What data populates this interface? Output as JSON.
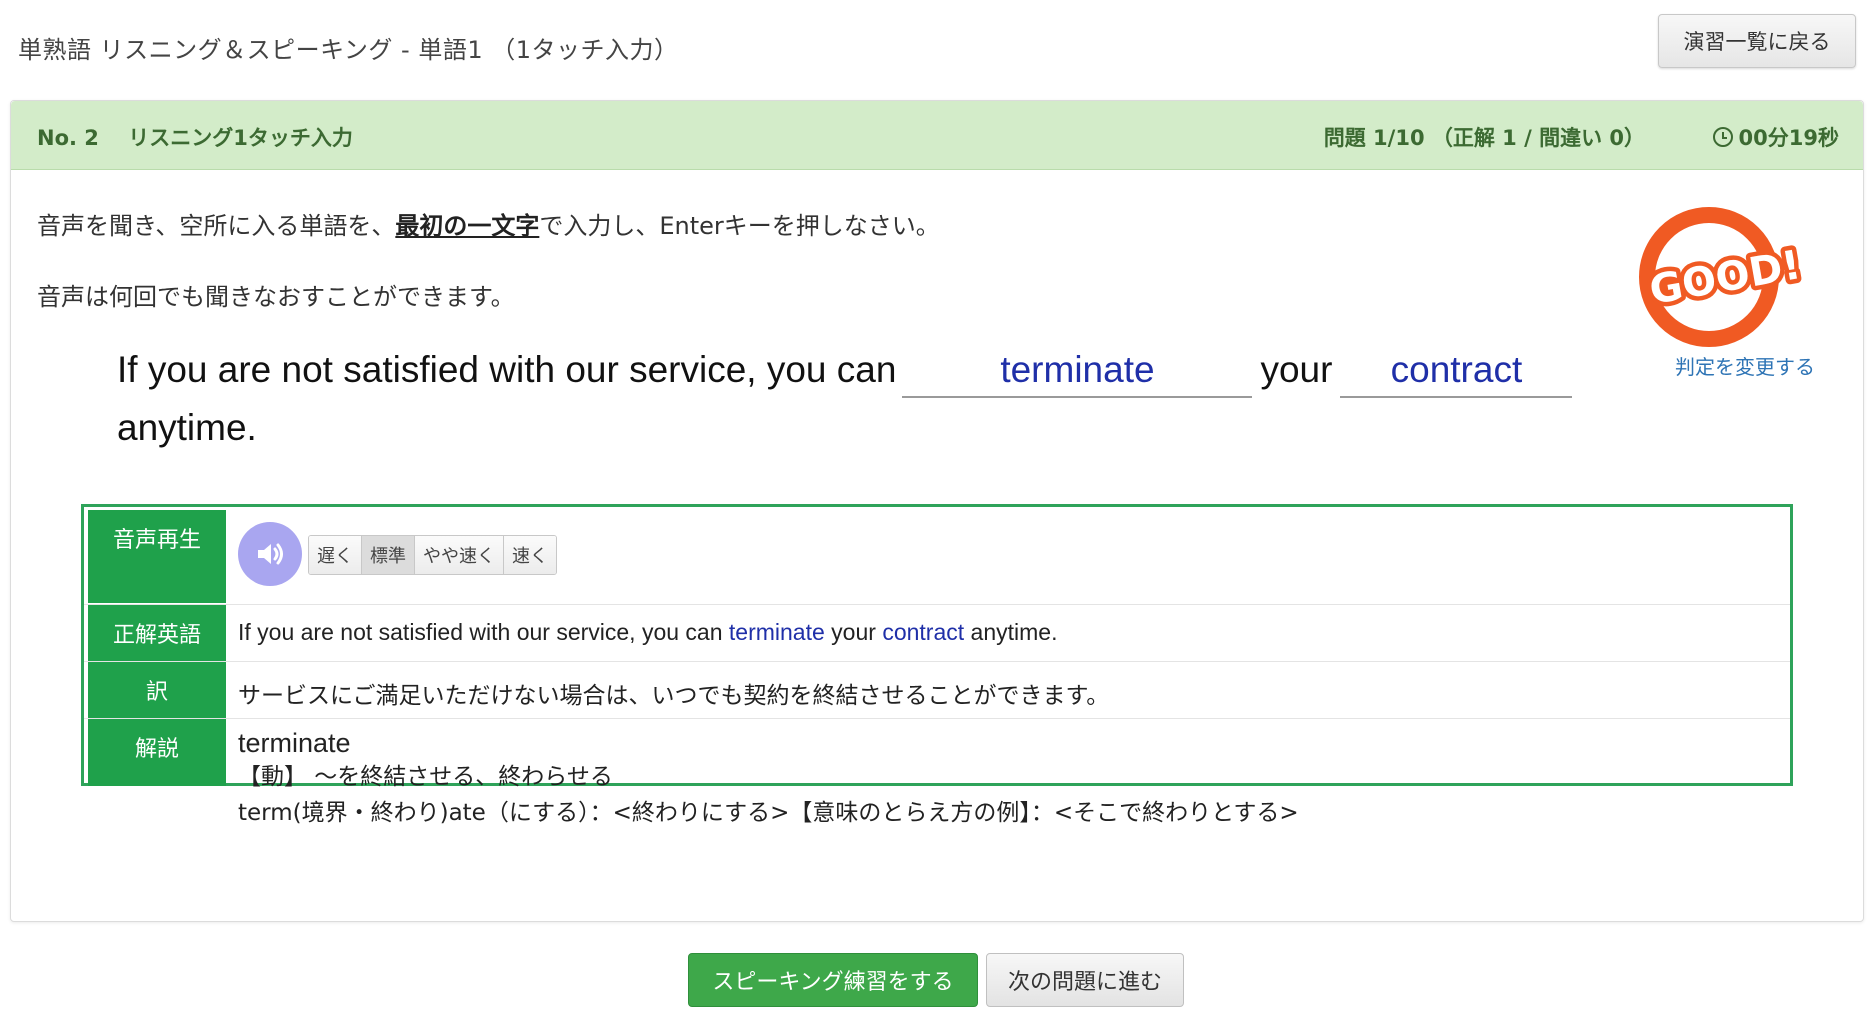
{
  "header": {
    "title": "単熟語 リスニング＆スピーキング - 単語1 （1タッチ入力）",
    "back_label": "演習一覧に戻る"
  },
  "question": {
    "number": "No. 2",
    "mode": "リスニング1タッチ入力",
    "progress": "問題 1/10 （正解 1 / 間違い 0）",
    "timer": "00分19秒"
  },
  "instructions": {
    "line1_pre": "音声を聞き、空所に入る単語を、",
    "line1_emph": "最初の一文字",
    "line1_post": "で入力し、Enterキーを押しなさい。",
    "line2": "音声は何回でも聞きなおすことができます。"
  },
  "judgement": {
    "stamp_text": "GOOD!",
    "change_link": "判定を変更する",
    "stamp_color": "#f05a23"
  },
  "sentence": {
    "part1": "If you are not satisfied with our service, you can",
    "blank1": "terminate",
    "part2": "your",
    "blank2": "contract",
    "part3": "anytime."
  },
  "info": {
    "audio_label": "音声再生",
    "speeds": [
      "遅く",
      "標準",
      "やや速く",
      "速く"
    ],
    "active_speed": "標準",
    "answer_label": "正解英語",
    "answer": {
      "pre": "If you are not satisfied with our service, you can ",
      "w1": "terminate",
      "mid": " your ",
      "w2": "contract",
      "post": " anytime."
    },
    "translation_label": "訳",
    "translation": "サービスにご満足いただけない場合は、いつでも契約を終結させることができます。",
    "explanation_label": "解説",
    "explanation": {
      "word": "terminate",
      "pos": "【動】 ～を終結させる、終わらせる",
      "etymology": "term(境界・終わり)ate（にする）：<終わりにする>【意味のとらえ方の例】：<そこで終わりとする>"
    }
  },
  "footer": {
    "speaking_label": "スピーキング練習をする",
    "next_label": "次の問題に進む"
  },
  "colors": {
    "accent_green": "#1fa14b",
    "header_green": "#d3ecc9",
    "answer_blue": "#1f2fa8",
    "speaker_purple": "#a9a6f0"
  }
}
